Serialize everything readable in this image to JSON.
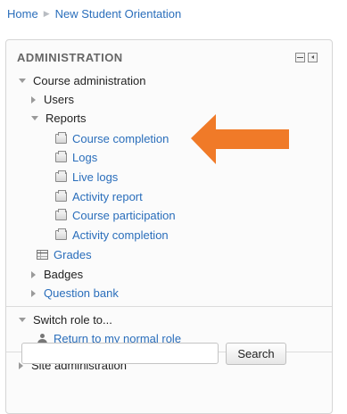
{
  "breadcrumb": {
    "home": "Home",
    "current": "New Student Orientation"
  },
  "block": {
    "title": "ADMINISTRATION",
    "course_admin": {
      "label": "Course administration",
      "users": "Users",
      "reports": {
        "label": "Reports",
        "items": [
          "Course completion",
          "Logs",
          "Live logs",
          "Activity report",
          "Course participation",
          "Activity completion"
        ]
      },
      "grades": "Grades",
      "badges": "Badges",
      "question_bank": "Question bank"
    },
    "switch_role": {
      "label": "Switch role to...",
      "return": "Return to my normal role"
    },
    "site_admin": "Site administration",
    "search": {
      "placeholder": "",
      "button": "Search"
    }
  },
  "colors": {
    "link": "#2a6ebb",
    "arrow": "#f07a28"
  }
}
